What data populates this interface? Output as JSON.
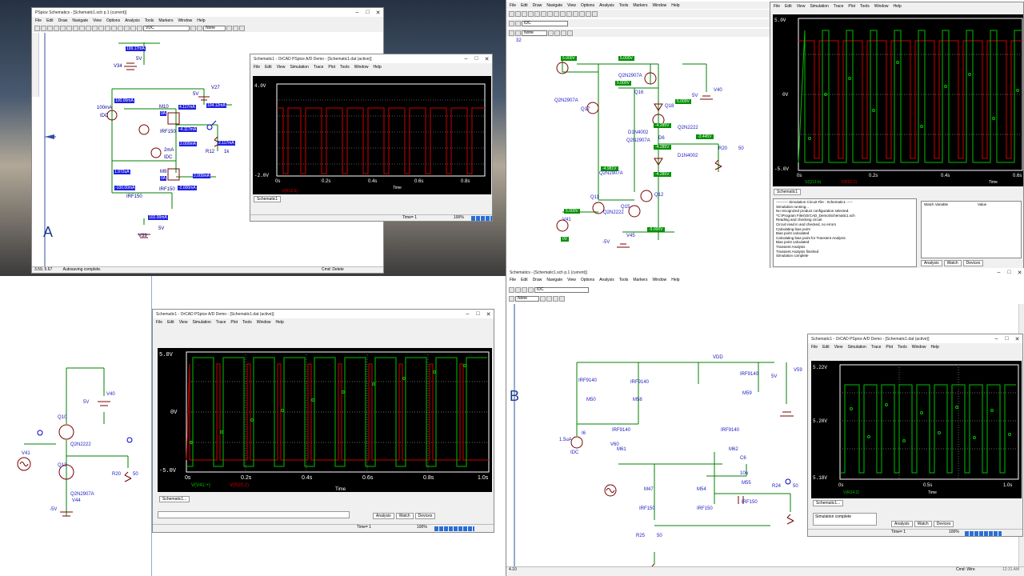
{
  "colors": {
    "wire": "#008000",
    "probe": "#0000ff",
    "scope_bg": "#000000",
    "trace_red": "#cc0000",
    "trace_green": "#00c000",
    "label": "#00008b"
  },
  "tl": {
    "title": "PSpice Schematics - [Schematic1.sch p.1 (current)]",
    "menu": [
      "File",
      "Edit",
      "Draw",
      "Navigate",
      "View",
      "Options",
      "Analysis",
      "Tools",
      "Markers",
      "Window",
      "Help"
    ],
    "part_sel": "VDC",
    "none_sel": "None",
    "status_left": "3.59, 5.67",
    "status_mid": "Autosaving complete.",
    "status_right": "Cmd: Delete",
    "big_letter": "A",
    "labels": {
      "i_top": "199.17mA",
      "v34_5v": "5V",
      "v34": "V34",
      "v27": "V27",
      "v27_5v": "5V",
      "i_104": "104.12mA",
      "idc_100": "100.00mA",
      "idc_100_lbl": "100mA",
      "idc": "IDC",
      "m10": "M10",
      "i_4117a": "4.117mA",
      "i_0a": "0A",
      "irf150a": "IRF150",
      "i_4117b": "-4.117mA",
      "r12": "R12",
      "r12_val": "1k",
      "i_2117": "2.117mA",
      "idc2_lbl": "2mA",
      "idc2": "IDC",
      "i_2000a": "2.000mA",
      "m9": "M9",
      "i_1972": "1.972uA",
      "i_0b": "0A",
      "i_2000b": "2.000mA",
      "irf150b": "IRF150",
      "i_m100": "-100.00mA",
      "i_m2000": "-2.000mA",
      "irf150c": "IRF150",
      "i_102": "102.00mA",
      "v39_5v": "5V",
      "v39": "V39"
    },
    "scope": {
      "title": "Schematic1 - OrCAD PSpice A/D Demo - [Schematic1.dat (active)]",
      "menu": [
        "File",
        "Edit",
        "View",
        "Simulation",
        "Trace",
        "Plot",
        "Tools",
        "Window",
        "Help"
      ],
      "y_top": "4.0V",
      "y_bot": "-2.0V",
      "x_ticks": [
        "0s",
        "0.2s",
        "0.4s",
        "0.6s",
        "0.8s"
      ],
      "xlabel": "Time",
      "legend": "V(R12:2)",
      "tab": "Schematic1",
      "status_time": "Time= 1",
      "status_pct": "100%"
    }
  },
  "tr": {
    "menu": [
      "File",
      "Edit",
      "Draw",
      "Navigate",
      "View",
      "Options",
      "Analysis",
      "Tools",
      "Markers",
      "Window",
      "Help"
    ],
    "part_sel": "IDC",
    "none_sel": "None",
    "num": "32",
    "labels": {
      "v5a": "5.000V",
      "v5b": "5.000V",
      "q2n2907a_1": "Q2N2907A",
      "q2n2907a_2": "Q2N2907A",
      "v5c": "5.000V",
      "q16": "Q16",
      "q17": "Q17",
      "v40": "V40",
      "v40_5v": "5V",
      "q18": "Q18",
      "v5d": "5.000V",
      "d1n4002a": "D1N4002",
      "v_m4285a": "-4.285V",
      "q2n2222": "Q2N2222",
      "d6": "D6",
      "q2n2907a_3": "Q2N2907A",
      "v_m4285b": "-4.285V",
      "v_m3445": "-3.445V",
      "r20": "R20",
      "r20_val": "50",
      "d1n4002b": "D1N4002",
      "v_m4981": "-4.981V",
      "q2n2907a_4": "Q2N2907A",
      "v_m4285c": "-4.285V",
      "q12": "Q12",
      "q11": "Q11",
      "q15": "Q15",
      "v5e": "5.000V",
      "q2n2222b": "Q2N2222",
      "v41": "V41",
      "v0": "0V",
      "vm5": "-5V",
      "v45": "V45",
      "v_m5000": "-5.000V"
    },
    "scope": {
      "menu": [
        "File",
        "Edit",
        "View",
        "Simulation",
        "Trace",
        "Plot",
        "Tools",
        "Window",
        "Help"
      ],
      "y_top": "5.0V",
      "y_mid": "0V",
      "y_bot": "-5.0V",
      "x_ticks": [
        "0s",
        "0.2s",
        "0.4s",
        "0.6s"
      ],
      "xlabel": "Time",
      "legend_a": "V(Q13:b)",
      "legend_b": "V(R20:2)",
      "tab": "Schematic1"
    },
    "log": [
      "---------- Simulation Circuit File : Schematic1 -----",
      "Simulation running...",
      "No recognized product configuration selected.",
      "*C:\\Program Files\\OrCAD_Demo\\Schematic1.sch",
      "Reading and checking circuit",
      "Circuit read in and checked, no errors",
      "Calculating bias point",
      "Bias point calculated",
      "Calculating bias point for Transient Analysis",
      "Bias point calculated",
      "Transient Analysis",
      "Transient Analysis finished",
      "Simulation complete"
    ],
    "watch_cols": [
      "Watch Variable",
      "Value"
    ],
    "watch_tabs": [
      "Analysis",
      "Watch",
      "Devices"
    ]
  },
  "bl": {
    "labels": {
      "q10": "Q10",
      "v40": "V40",
      "v40_5v": "5V",
      "q2n2222": "Q2N2222",
      "v41": "V41",
      "q13": "Q13",
      "r20": "R20",
      "r20_val": "50",
      "q2n2907a": "Q2N2907A",
      "v44": "V44",
      "vm5": "-5V"
    },
    "scope": {
      "title": "Schematic1 - OrCAD PSpice A/D Demo - [Schematic1.dat (active)]",
      "menu": [
        "File",
        "Edit",
        "View",
        "Simulation",
        "Trace",
        "Plot",
        "Tools",
        "Window",
        "Help"
      ],
      "y_top": "5.0V",
      "y_mid": "0V",
      "y_bot": "-5.0V",
      "x_ticks": [
        "0s",
        "0.2s",
        "0.4s",
        "0.6s",
        "0.8s",
        "1.0s"
      ],
      "xlabel": "Time",
      "legend_a": "V(V41:+)",
      "legend_b": "V(R20:2)",
      "tab": "Schematic1...",
      "tabs": [
        "Analysis",
        "Watch",
        "Devices"
      ],
      "status_time": "Time= 1",
      "status_pct": "100%"
    }
  },
  "br": {
    "title": "Schematics - [Schematic1.sch p.1 (current)]",
    "menu": [
      "File",
      "Edit",
      "Draw",
      "Navigate",
      "View",
      "Options",
      "Analysis",
      "Tools",
      "Markers",
      "Window",
      "Help"
    ],
    "part_sel": "IDC",
    "none_sel": "None",
    "big_letter": "B",
    "labels": {
      "vdd": "VDD",
      "irf9140a": "IRF9140",
      "irf9140b": "IRF9140",
      "irf9140c": "IRF9140",
      "m50": "M50",
      "m58": "M58",
      "m59": "M59",
      "v59": "V59",
      "v59_5v": "5V",
      "i6": "I6",
      "i_val": "1.5uA",
      "idc": "IDC",
      "irf9140d": "IRF9140",
      "irf9140e": "IRF9140",
      "v60": "V60",
      "m61": "M61",
      "m62": "M62",
      "c6": "C6",
      "c6_val": "10u",
      "m47": "M47",
      "m54": "M54",
      "m55": "M55",
      "r24": "R24",
      "r24_val": "50",
      "irf150a": "IRF150",
      "irf150b": "IRF150",
      "irf150c": "IRF150",
      "r25": "R25",
      "r25_val": "50"
    },
    "scope": {
      "title": "Schematic1 - OrCAD PSpice A/D Demo - [Schematic1.dat (active)]",
      "menu": [
        "File",
        "Edit",
        "View",
        "Simulation",
        "Trace",
        "Plot",
        "Tools",
        "Window",
        "Help"
      ],
      "y_top": "5.22V",
      "y_mid": "5.20V",
      "y_bot": "5.18V",
      "x_ticks": [
        "0s",
        "0.5s",
        "1.0s"
      ],
      "xlabel": "Time",
      "legend": "V(R24:2)",
      "tab": "Schematic1...",
      "sim_status": "Simulation complete",
      "tabs": [
        "Analysis",
        "Watch",
        "Devices"
      ],
      "status_time": "Time= 1",
      "status_pct": "100%"
    },
    "status_left": "4.10",
    "status_right": "Cmd: Wire",
    "clock": "12:31 AM"
  }
}
